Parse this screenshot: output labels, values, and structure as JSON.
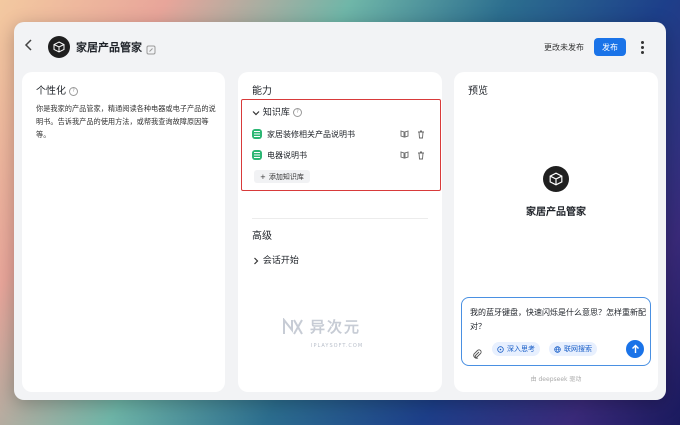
{
  "header": {
    "title": "家居产品管家",
    "unpublished_label": "更改未发布",
    "publish_label": "发布"
  },
  "persona": {
    "title": "个性化",
    "text": "你是我家的产品管家，精通阅读各种电器或电子产品的说明书。告诉我产品的使用方法，或帮我查询故障原因等等。"
  },
  "abilities": {
    "title": "能力",
    "knowledge": {
      "title": "知识库",
      "items": [
        {
          "label": "家居装修相关产品说明书"
        },
        {
          "label": "电器说明书"
        }
      ],
      "add_label": "添加知识库"
    },
    "advanced": {
      "title": "高级",
      "item_label": "会话开始"
    }
  },
  "preview": {
    "title": "预览",
    "bot_name": "家居产品管家",
    "input_text": "我的蓝牙键盘，快速闪烁是什么意思？怎样重新配对？",
    "deep_think_label": "深入思考",
    "web_search_label": "联网搜索",
    "footer": "由 deepseek 驱动"
  },
  "watermark": {
    "text": "异次元",
    "sub": "IPLAYSOFT.COM"
  },
  "colors": {
    "accent": "#1a73e8",
    "highlight_border": "#d83a3a",
    "kb_icon": "#2bb673"
  }
}
